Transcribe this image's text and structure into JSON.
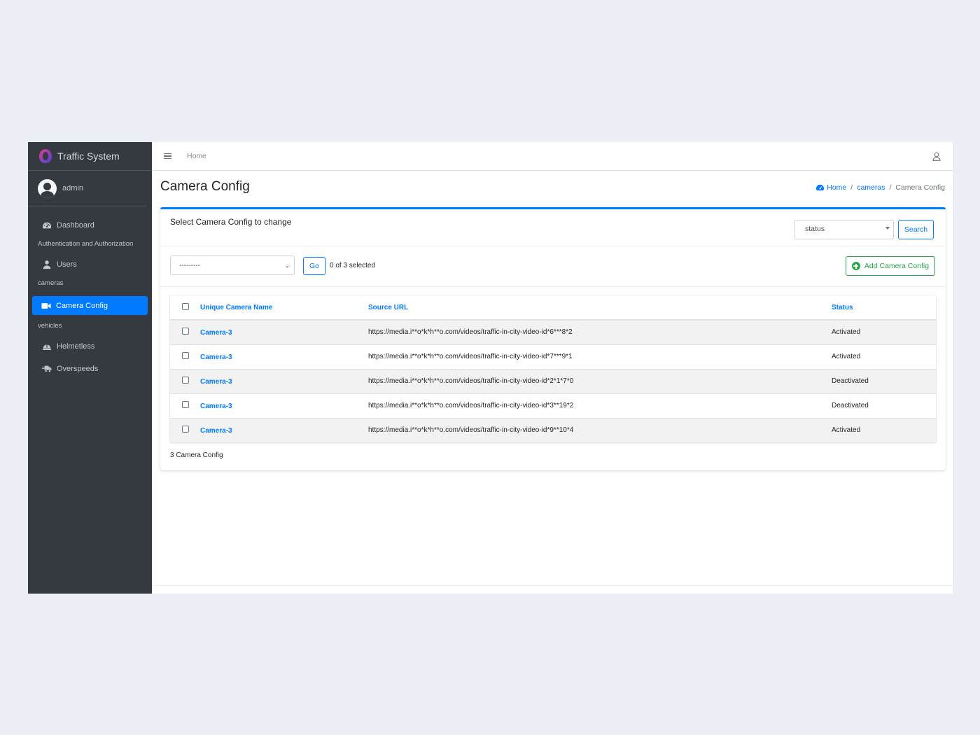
{
  "sidebar": {
    "brand": "Traffic System",
    "user": "admin",
    "items": [
      {
        "type": "item",
        "label": "Dashboard",
        "icon": "dashboard-icon"
      },
      {
        "type": "header",
        "label": "Authentication and Authorization"
      },
      {
        "type": "item",
        "label": "Users",
        "icon": "user-icon"
      },
      {
        "type": "header",
        "label": "cameras"
      },
      {
        "type": "item",
        "label": "Camera Config",
        "icon": "video-camera-icon",
        "active": true
      },
      {
        "type": "header",
        "label": "vehicles"
      },
      {
        "type": "item",
        "label": "Helmetless",
        "icon": "helmet-icon"
      },
      {
        "type": "item",
        "label": "Overspeeds",
        "icon": "truck-speed-icon"
      }
    ]
  },
  "topbar": {
    "home": "Home"
  },
  "page": {
    "title": "Camera Config",
    "breadcrumb": {
      "home": "Home",
      "section": "cameras",
      "current": "Camera Config",
      "sep": "/"
    }
  },
  "changelist": {
    "header_title": "Select Camera Config to change",
    "search_select_value": "status",
    "search_button": "Search",
    "action_select_value": "---------",
    "go_button": "Go",
    "selected_text": "0 of 3 selected",
    "add_button": "Add Camera Config",
    "columns": {
      "name": "Unique Camera Name",
      "url": "Source URL",
      "status": "Status"
    },
    "rows": [
      {
        "name": "Camera-3",
        "url": "https://media.i**o*k*h**o.com/videos/traffic-in-city-video-id*6***8*2",
        "status": "Activated"
      },
      {
        "name": "Camera-3",
        "url": "https://media.i**o*k*h**o.com/videos/traffic-in-city-video-id*7***9*1",
        "status": "Activated"
      },
      {
        "name": "Camera-3",
        "url": "https://media.i**o*k*h**o.com/videos/traffic-in-city-video-id*2*1*7*0",
        "status": "Deactivated"
      },
      {
        "name": "Camera-3",
        "url": "https://media.i**o*k*h**o.com/videos/traffic-in-city-video-id*3**19*2",
        "status": "Deactivated"
      },
      {
        "name": "Camera-3",
        "url": "https://media.i**o*k*h**o.com/videos/traffic-in-city-video-id*9**10*4",
        "status": "Activated"
      }
    ],
    "footer_count": "3 Camera Config"
  },
  "colors": {
    "primary": "#007bff",
    "success": "#28a745",
    "sidebar_bg": "#343a40"
  }
}
